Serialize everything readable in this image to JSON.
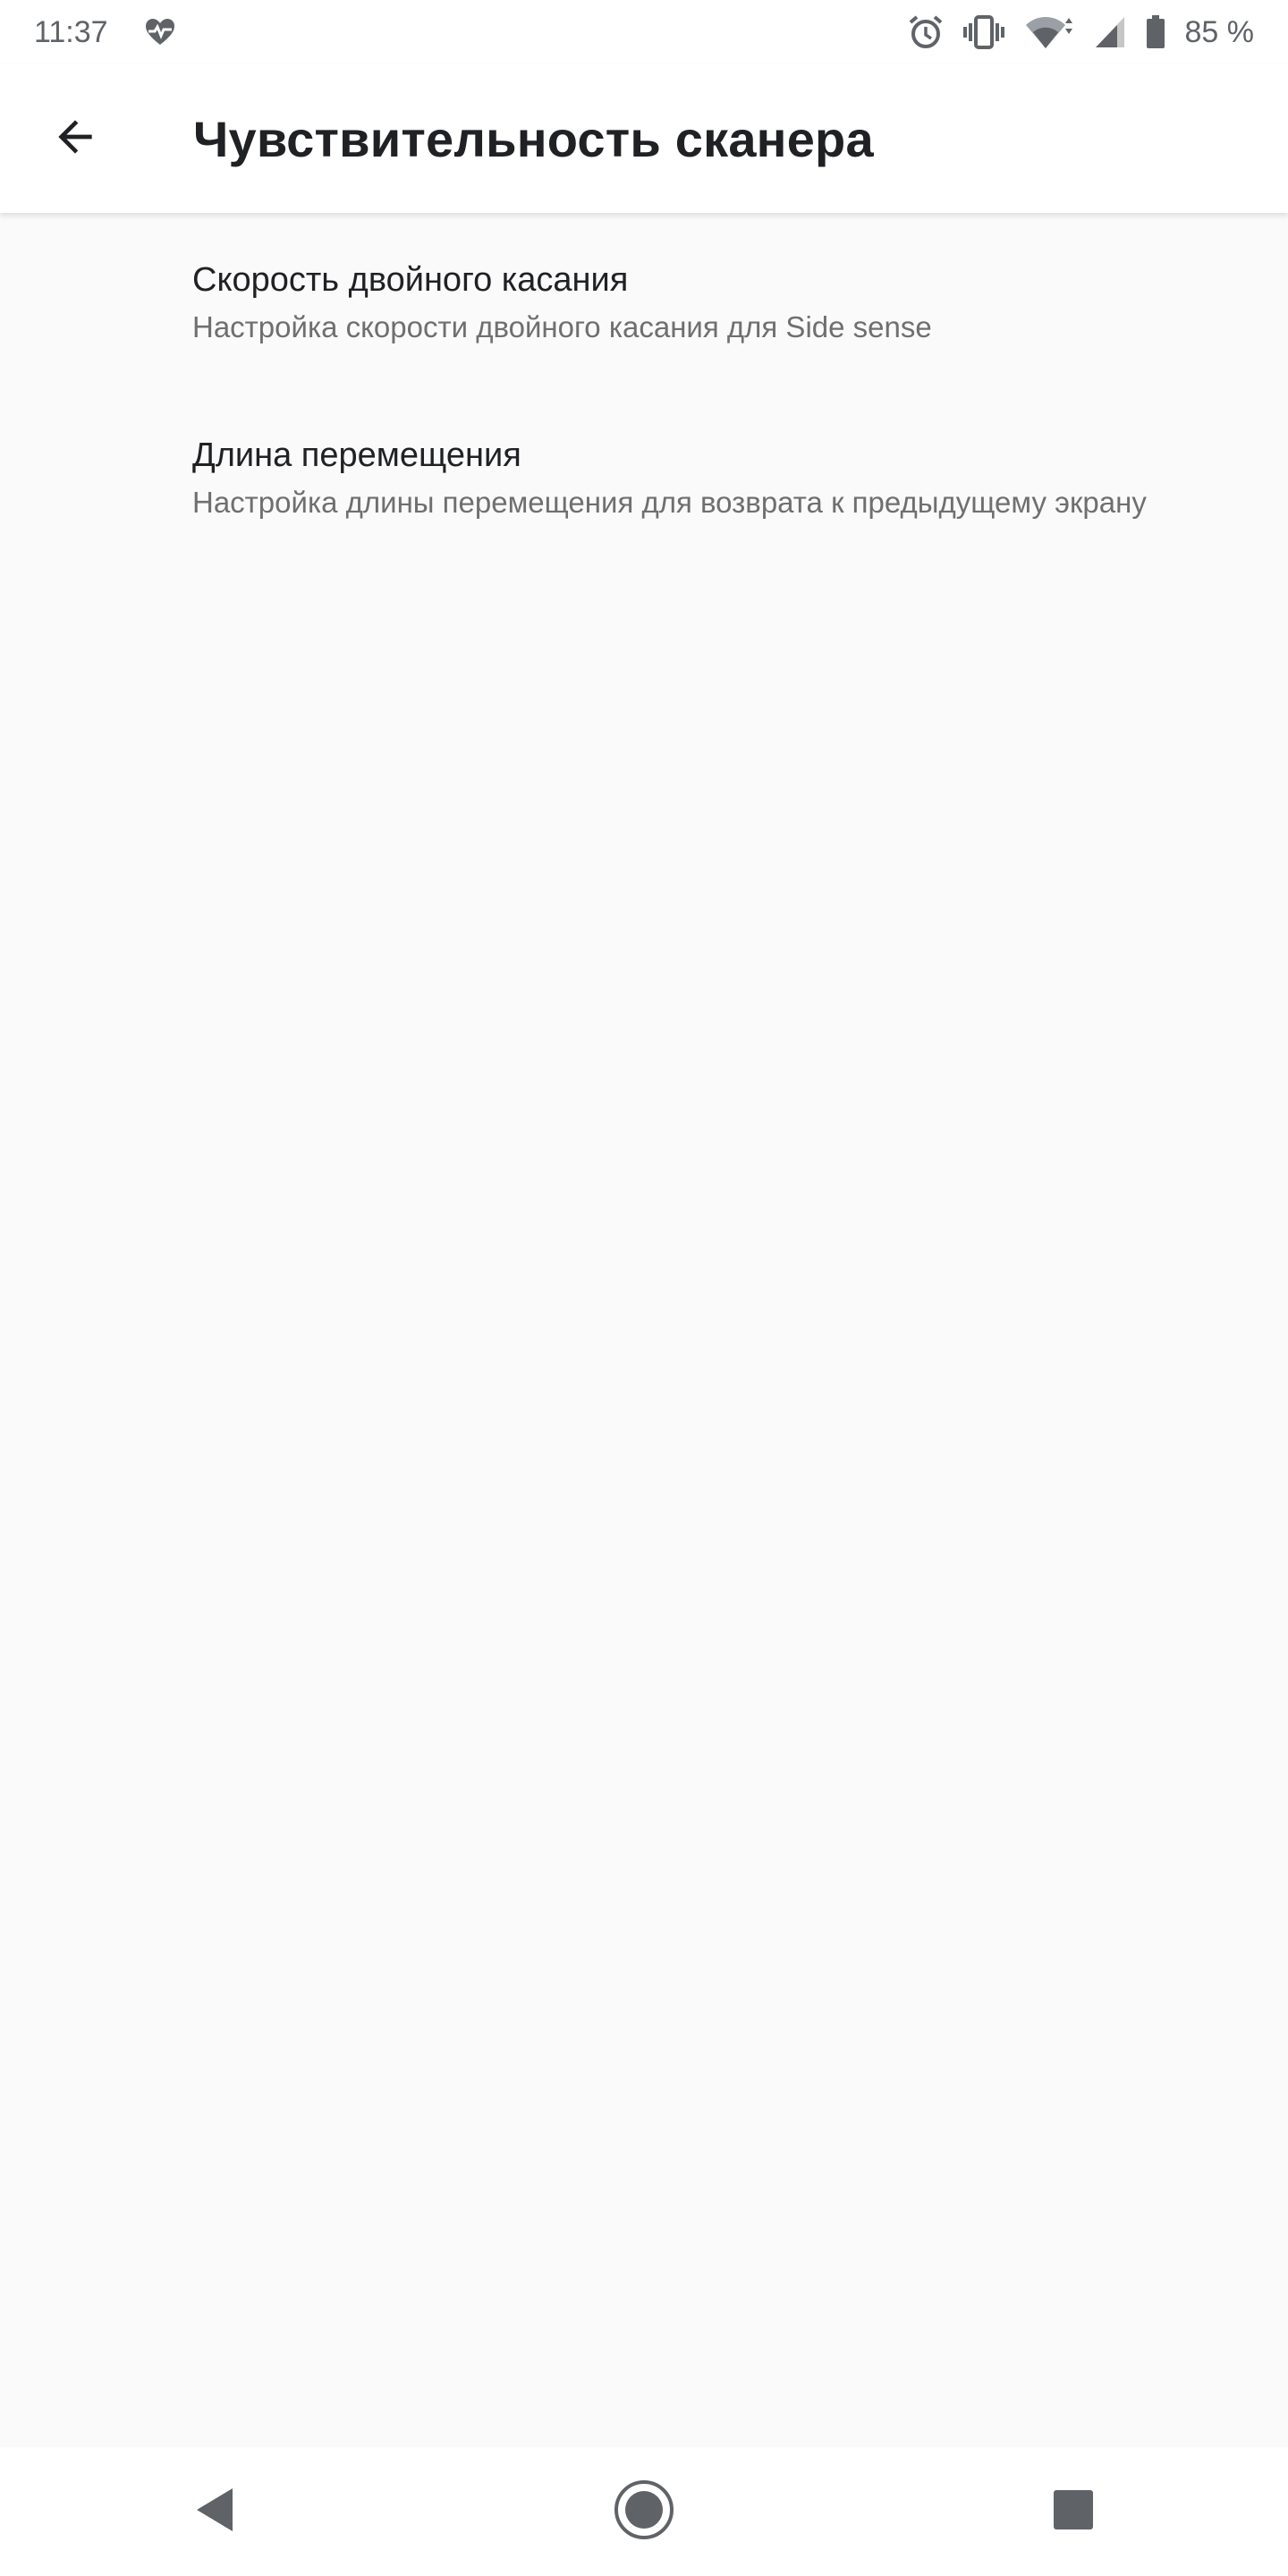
{
  "status_bar": {
    "time": "11:37",
    "battery": "85 %",
    "icons": [
      "heart-pulse-icon",
      "alarm-icon",
      "vibrate-icon",
      "wifi-icon",
      "signal-icon",
      "battery-icon"
    ]
  },
  "app_bar": {
    "title": "Чувствительность сканера",
    "back_icon": "arrow-back-icon"
  },
  "settings": {
    "items": [
      {
        "title": "Скорость двойного касания",
        "subtitle": "Настройка скорости двойного касания для Side sense"
      },
      {
        "title": "Длина перемещения",
        "subtitle": "Настройка длины перемещения для возврата к предыдущему экрану"
      }
    ]
  },
  "nav_bar": {
    "icons": [
      "nav-back-icon",
      "nav-home-icon",
      "nav-recents-icon"
    ]
  },
  "colors": {
    "background": "#fafafa",
    "surface": "#ffffff",
    "title_text": "#202124",
    "secondary_text": "#6f6f6f",
    "icon": "#5f6368"
  }
}
